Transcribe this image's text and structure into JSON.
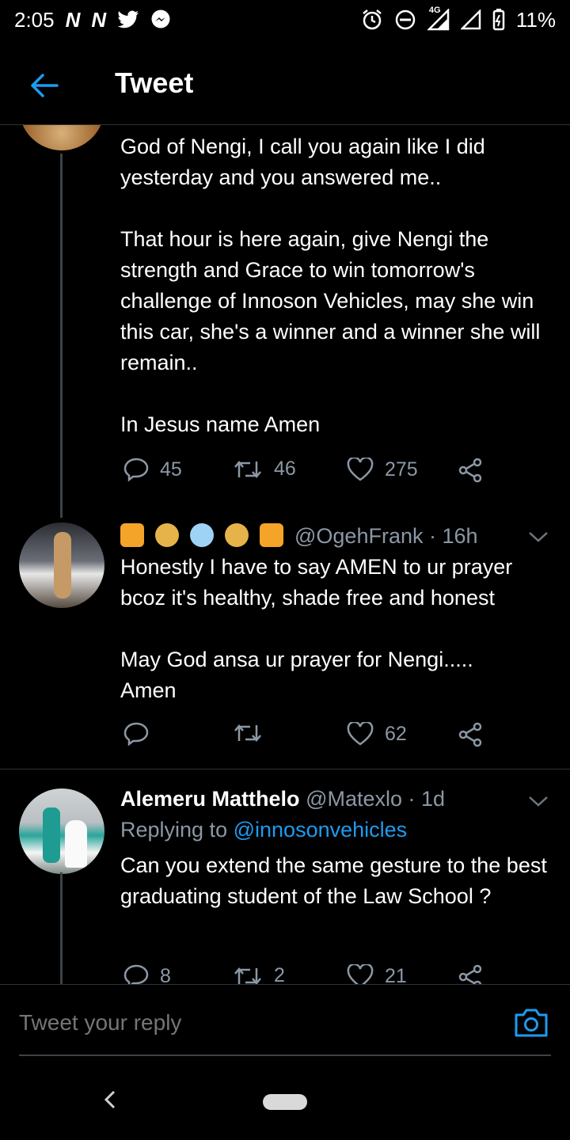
{
  "status_bar": {
    "time": "2:05",
    "left_icons": [
      "N",
      "N",
      "twitter-bird",
      "messenger"
    ],
    "network": "4G",
    "battery": "11%"
  },
  "header": {
    "title": "Tweet"
  },
  "tweets": [
    {
      "text": "God of Nengi, I call you again like I did yesterday and you answered me..\n\nThat hour is here again, give Nengi the strength and Grace to win tomorrow's challenge of Innoson Vehicles, may she win this car, she's a winner and a winner she will remain..\n\nIn Jesus name Amen",
      "replies": "45",
      "retweets": "46",
      "likes": "275"
    },
    {
      "name_emojis": [
        "shield",
        "money-bag",
        "snowflake",
        "money-bag",
        "shield"
      ],
      "handle": "@OgehFrank",
      "time": "16h",
      "text": "Honestly I have to say AMEN to ur prayer bcoz it's healthy, shade free and honest\n\nMay God ansa ur prayer for Nengi.....\nAmen",
      "replies": "",
      "retweets": "",
      "likes": "62"
    },
    {
      "name": "Alemeru Matthelo",
      "handle": "@Matexlo",
      "time": "1d",
      "replying_label": "Replying to",
      "replying_to": "@innosonvehicles",
      "text": "Can you extend the same gesture to the best graduating student of the Law School ?",
      "replies": "8",
      "retweets": "2",
      "likes": "21"
    }
  ],
  "reply_bar": {
    "placeholder": "Tweet your reply"
  },
  "colors": {
    "accent": "#1d9bf0",
    "muted": "#8b98a5",
    "background": "#000000",
    "divider": "#2f3336"
  }
}
